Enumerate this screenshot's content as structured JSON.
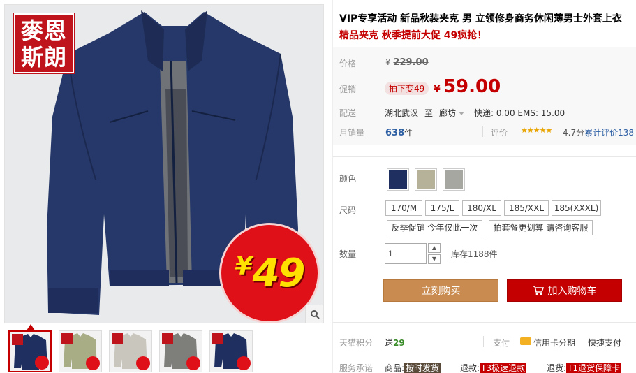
{
  "brand_logo": {
    "line1": "麥恩",
    "line2": "斯朗"
  },
  "price_burst": {
    "currency": "¥",
    "amount": "49"
  },
  "thumbnails": [
    {
      "color": "#1f3060",
      "active": true
    },
    {
      "color": "#a9ad86",
      "active": false
    },
    {
      "color": "#c8c6bd",
      "active": false
    },
    {
      "color": "#7e7f7a",
      "active": false
    },
    {
      "color": "#1f3060",
      "active": false
    }
  ],
  "product": {
    "title": "VIP专享活动 新品秋装夹克 男 立领修身商务休闲薄男士外套上衣",
    "subtitle": "精品夹克 秋季提前大促 49疯抢！"
  },
  "price": {
    "label": "价格",
    "currency": "¥",
    "original": "229.00",
    "promo_label": "促销",
    "promo_tag": "拍下变49",
    "promo_currency": "¥",
    "promo_value": "59.00"
  },
  "shipping": {
    "label": "配送",
    "from": "湖北武汉",
    "to_word": "至",
    "destination": "廊坊",
    "fee": "快递: 0.00 EMS: 15.00"
  },
  "sales": {
    "label": "月销量",
    "count": "638",
    "unit": "件",
    "rating_label": "评价",
    "stars": "★★★★★",
    "score": "4.7分",
    "reviews": "累计评价138"
  },
  "options": {
    "color_label": "颜色",
    "colors": [
      "#1f3060",
      "#b6b29a",
      "#a7a7a2"
    ],
    "size_label": "尺码",
    "sizes": [
      "170/M",
      "175/L",
      "180/XL",
      "185/XXL",
      "185(XXXL)"
    ],
    "promo_options": [
      "反季促销 今年仅此一次",
      "拍套餐更划算 请咨询客服"
    ],
    "qty_label": "数量",
    "qty_value": "1",
    "stock": "库存1188件"
  },
  "actions": {
    "buy": "立刻购买",
    "cart": "加入购物车"
  },
  "footer": {
    "points_label": "天猫积分",
    "points_prefix": "送",
    "points_value": "29",
    "pay_label": "支付",
    "pay_card": "信用卡分期",
    "pay_fast": "快捷支付",
    "service_label": "服务承诺",
    "svc1_pre": "商品:",
    "svc1_tag": "按时发货",
    "svc2_pre": "退款:",
    "svc2_tag": "T3极速退款",
    "svc3_pre": "退货:",
    "svc3_tag": "T1退货保障卡"
  }
}
